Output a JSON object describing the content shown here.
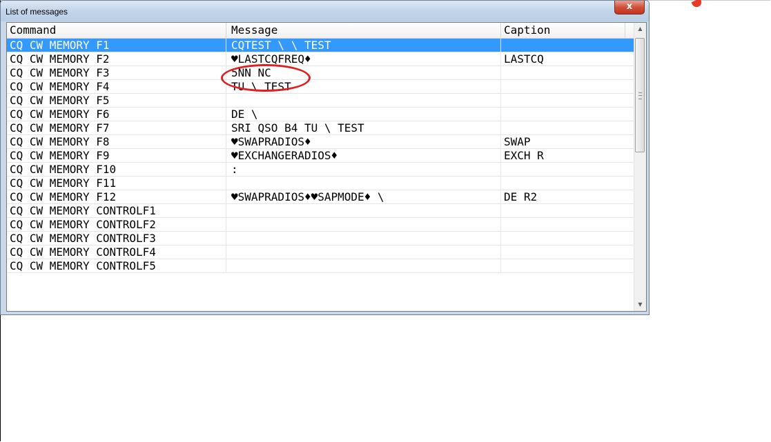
{
  "window": {
    "title": "List of messages",
    "close_glyph": "x"
  },
  "columns": [
    "Command",
    "Message",
    "Caption"
  ],
  "rows": [
    {
      "command": "CQ CW MEMORY F1",
      "message": "CQTEST \\ \\ TEST",
      "caption": "",
      "selected": true
    },
    {
      "command": "CQ CW MEMORY F2",
      "message": "♥LASTCQFREQ♦",
      "caption": "LASTCQ"
    },
    {
      "command": "CQ CW MEMORY F3",
      "message": "5NN NC",
      "caption": ""
    },
    {
      "command": "CQ CW MEMORY F4",
      "message": "TU \\ TEST",
      "caption": ""
    },
    {
      "command": "CQ CW MEMORY F5",
      "message": "",
      "caption": ""
    },
    {
      "command": "CQ CW MEMORY F6",
      "message": "DE \\",
      "caption": ""
    },
    {
      "command": "CQ CW MEMORY F7",
      "message": "SRI QSO B4 TU \\ TEST",
      "caption": ""
    },
    {
      "command": "CQ CW MEMORY F8",
      "message": "♥SWAPRADIOS♦",
      "caption": "SWAP"
    },
    {
      "command": "CQ CW MEMORY F9",
      "message": "♥EXCHANGERADIOS♦",
      "caption": "EXCH R"
    },
    {
      "command": "CQ CW MEMORY F10",
      "message": ":",
      "caption": ""
    },
    {
      "command": "CQ CW MEMORY F11",
      "message": "",
      "caption": ""
    },
    {
      "command": "CQ CW MEMORY F12",
      "message": "♥SWAPRADIOS♦♥SAPMODE♦ \\",
      "caption": "DE R2"
    },
    {
      "command": "CQ CW MEMORY CONTROLF1",
      "message": "",
      "caption": ""
    },
    {
      "command": "CQ CW MEMORY CONTROLF2",
      "message": "",
      "caption": ""
    },
    {
      "command": "CQ CW MEMORY CONTROLF3",
      "message": "",
      "caption": ""
    },
    {
      "command": "CQ CW MEMORY CONTROLF4",
      "message": "",
      "caption": ""
    },
    {
      "command": "CQ CW MEMORY CONTROLF5",
      "message": "",
      "caption": ""
    }
  ],
  "scrollbar": {
    "up_glyph": "▲",
    "down_glyph": "▼"
  },
  "colors": {
    "selection": "#3399ff",
    "annotation": "#e02020",
    "close_button": "#c2361f"
  }
}
